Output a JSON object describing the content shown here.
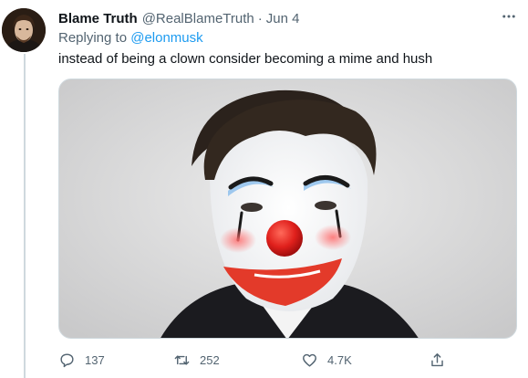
{
  "tweet": {
    "display_name": "Blame Truth",
    "handle": "@RealBlameTruth",
    "separator": "·",
    "date": "Jun 4",
    "reply_prefix": "Replying to",
    "reply_to": "@elonmusk",
    "text": "instead of being a clown consider becoming a mime and hush"
  },
  "actions": {
    "replies": "137",
    "retweets": "252",
    "likes": "4.7K"
  },
  "icons": {
    "more": "more-horizontal-icon",
    "reply": "comment-icon",
    "retweet": "retweet-icon",
    "like": "heart-icon",
    "share": "share-icon"
  },
  "colors": {
    "link": "#1d9bf0",
    "secondary_text": "#536471",
    "thread_line": "#cfd9de"
  }
}
